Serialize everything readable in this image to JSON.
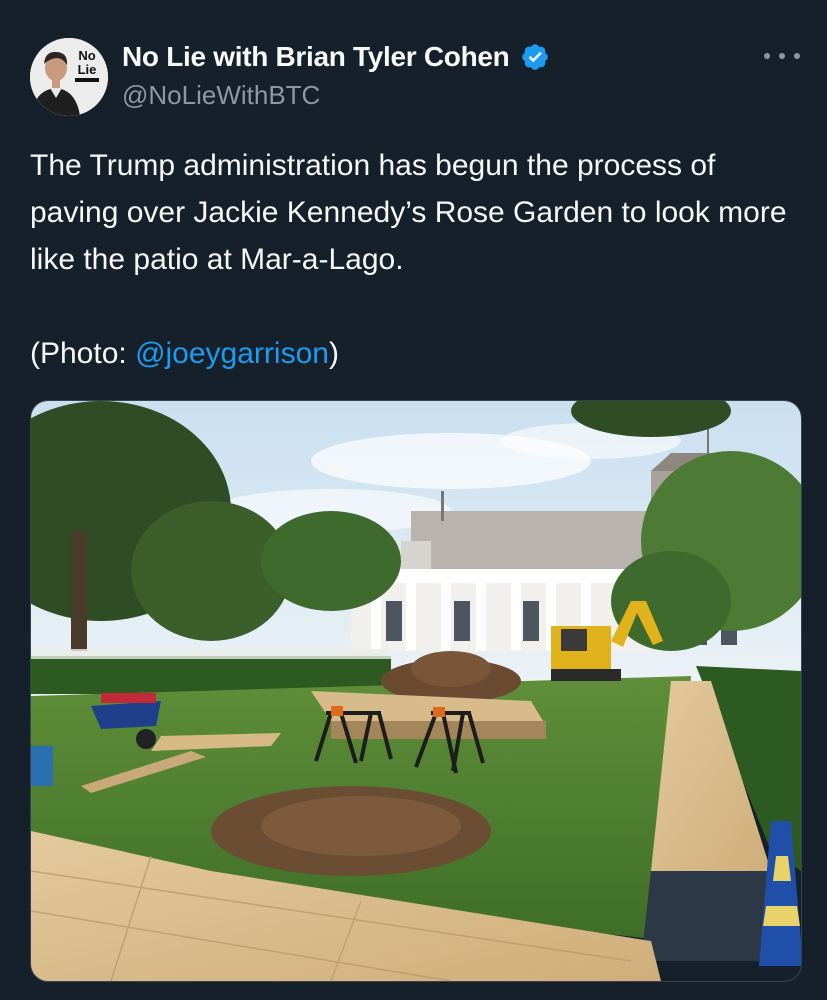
{
  "author": {
    "display_name": "No Lie with Brian Tyler Cohen",
    "handle": "@NoLieWithBTC",
    "avatar_logo_text": [
      "No",
      "Lie"
    ]
  },
  "tweet": {
    "text_paragraph_1": "The Trump administration has begun the process of paving over Jackie Kennedy’s Rose Garden to look more like the patio at Mar-a-Lago.",
    "photo_prefix": "(Photo: ",
    "photo_mention": "@joeygarrison",
    "photo_suffix": ")"
  },
  "colors": {
    "background": "#15202b",
    "text_primary": "#f7f9f9",
    "text_secondary": "#8b98a5",
    "accent_blue": "#1d9bf0"
  },
  "icons": {
    "verified": "verified-badge-icon",
    "more": "more-options-icon"
  }
}
